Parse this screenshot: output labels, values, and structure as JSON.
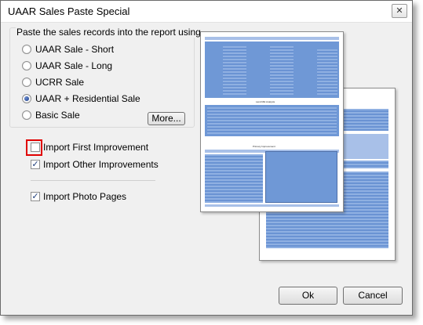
{
  "window": {
    "title": "UAAR Sales Paste Special"
  },
  "group": {
    "label": "Paste the sales records into the report using",
    "options": [
      {
        "label": "UAAR Sale - Short",
        "checked": false
      },
      {
        "label": "UAAR Sale - Long",
        "checked": false
      },
      {
        "label": "UCRR Sale",
        "checked": false
      },
      {
        "label": "UAAR + Residential Sale",
        "checked": true
      },
      {
        "label": "Basic Sale",
        "checked": false
      }
    ],
    "more_button": "More..."
  },
  "checkboxes": [
    {
      "label": "Import First Improvement",
      "checked": false
    },
    {
      "label": "Import Other Improvements",
      "checked": true
    },
    {
      "label": "Import Photo Pages",
      "checked": true
    }
  ],
  "preview": {
    "page1_sections": [
      "Land Mkt Analysis",
      "Primary Improvement"
    ]
  },
  "buttons": {
    "ok": "Ok",
    "cancel": "Cancel"
  },
  "colors": {
    "accent_highlight": "#e00000",
    "preview_blue": "#6f98d6"
  }
}
